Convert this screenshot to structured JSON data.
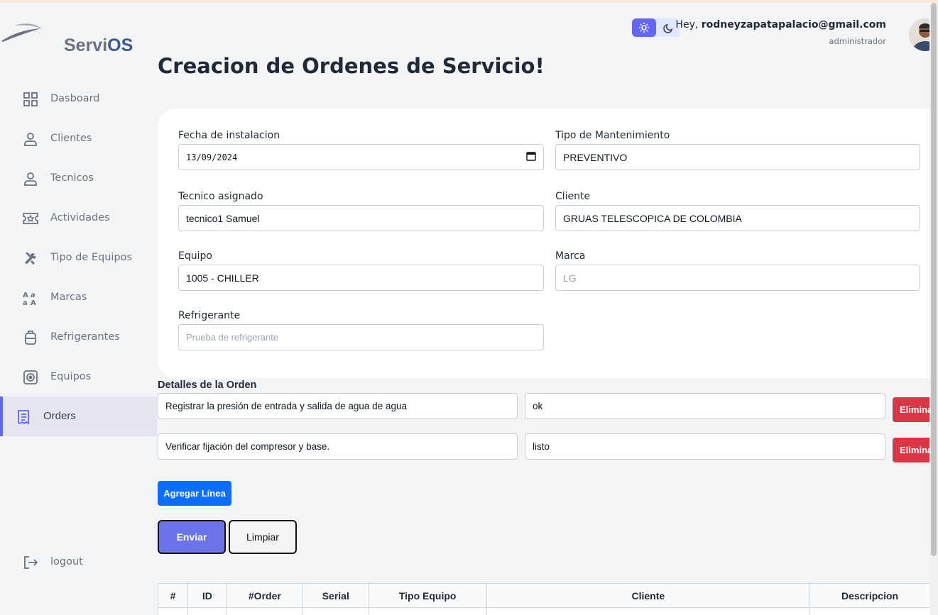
{
  "app": {
    "logo_text_a": "Servi",
    "logo_text_b": "OS"
  },
  "header": {
    "greeting_prefix": "Hey, ",
    "user_email": "rodneyzapatapalacio@gmail.com",
    "role": "administrador"
  },
  "sidebar": {
    "items": [
      {
        "label": "Dasboard",
        "icon": "grid-icon"
      },
      {
        "label": "Clientes",
        "icon": "user-icon"
      },
      {
        "label": "Tecnicos",
        "icon": "user-icon"
      },
      {
        "label": "Actividades",
        "icon": "ticket-icon"
      },
      {
        "label": "Tipo de Equipos",
        "icon": "tools-icon"
      },
      {
        "label": "Marcas",
        "icon": "text-case-icon"
      },
      {
        "label": "Refrigerantes",
        "icon": "tank-icon"
      },
      {
        "label": "Equipos",
        "icon": "fan-icon"
      },
      {
        "label": "Orders",
        "icon": "receipt-icon",
        "active": true
      }
    ],
    "logout_label": "logout"
  },
  "page": {
    "title": "Creacion de Ordenes de Servicio!"
  },
  "form": {
    "fecha_label": "Fecha de instalacion",
    "fecha_value": "13/09/2024",
    "tipo_label": "Tipo de Mantenimiento",
    "tipo_value": "PREVENTIVO",
    "tecnico_label": "Tecnico asignado",
    "tecnico_value": "tecnico1 Samuel",
    "cliente_label": "Cliente",
    "cliente_value": "GRUAS TELESCOPICA DE COLOMBIA",
    "equipo_label": "Equipo",
    "equipo_value": "1005 - CHILLER",
    "marca_label": "Marca",
    "marca_placeholder": "LG",
    "refrigerante_label": "Refrigerante",
    "refrigerante_placeholder": "Prueba de refrigerante"
  },
  "details": {
    "title": "Detalles de la Orden",
    "lines": [
      {
        "description": "Registrar la presión de entrada y salida de agua de agua",
        "result": "ok",
        "delete_label": "Eliminar"
      },
      {
        "description": "Verificar fijación del compresor y base.",
        "result": "listo",
        "delete_label": "Eliminar"
      }
    ],
    "add_label": "Agregar Línea"
  },
  "actions": {
    "send_label": "Enviar",
    "clear_label": "Limpiar"
  },
  "table": {
    "headers": [
      "#",
      "ID",
      "#Order",
      "Serial",
      "Tipo Equipo",
      "Cliente",
      "Descripcion"
    ]
  },
  "colors": {
    "accent": "#6366f1",
    "danger": "#dc3545",
    "primary": "#0d6efd"
  }
}
